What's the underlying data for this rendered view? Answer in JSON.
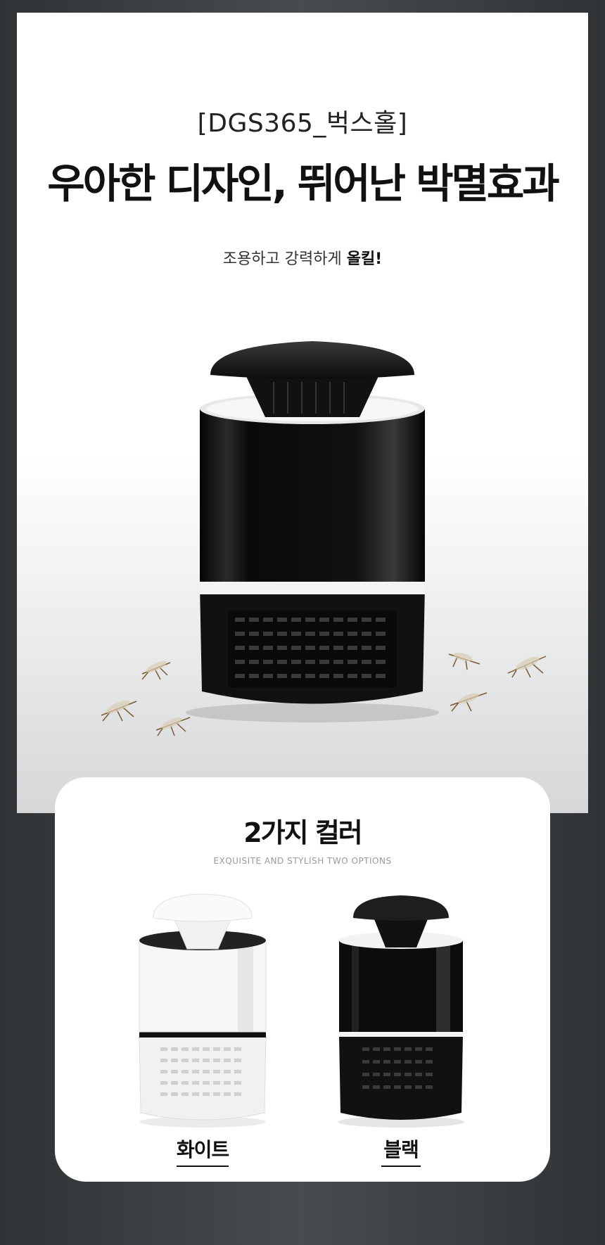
{
  "hero": {
    "model_tag": "[DGS365_벅스홀]",
    "headline": "우아한 디자인, 뛰어난 박멸효과",
    "tagline_prefix": "조용하고 강력하게 ",
    "tagline_emphasis": "올킬!"
  },
  "colors": {
    "background_frame": "#3a3e41",
    "lamp_black": "#0d0d0d",
    "lamp_white": "#f5f5f5",
    "text_dark": "#111111",
    "subtext_gray": "#9a9a9a"
  },
  "options_card": {
    "title": "2가지 컬러",
    "subtitle": "EXQUISITE AND STYLISH TWO OPTIONS",
    "options": [
      {
        "label": "화이트",
        "color_name": "white"
      },
      {
        "label": "블랙",
        "color_name": "black"
      }
    ]
  }
}
